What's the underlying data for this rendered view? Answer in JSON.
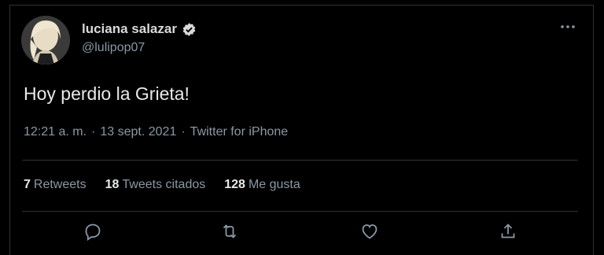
{
  "tweet": {
    "author_name": "luciana salazar",
    "author_handle": "@lulipop07",
    "text": "Hoy perdio la Grieta!",
    "time": "12:21 a. m.",
    "date": "13 sept. 2021",
    "source": "Twitter for iPhone",
    "separator": "·"
  },
  "stats": {
    "retweets_count": "7",
    "retweets_label": "Retweets",
    "quotes_count": "18",
    "quotes_label": "Tweets citados",
    "likes_count": "128",
    "likes_label": "Me gusta"
  },
  "icons": {
    "verified": "verified-badge-icon",
    "more": "more-icon",
    "reply": "reply-icon",
    "retweet": "retweet-icon",
    "like": "heart-icon",
    "share": "share-icon"
  },
  "colors": {
    "background": "#000000",
    "text": "#e7e9ea",
    "secondary": "#8b98a5",
    "border": "#2f3336"
  }
}
